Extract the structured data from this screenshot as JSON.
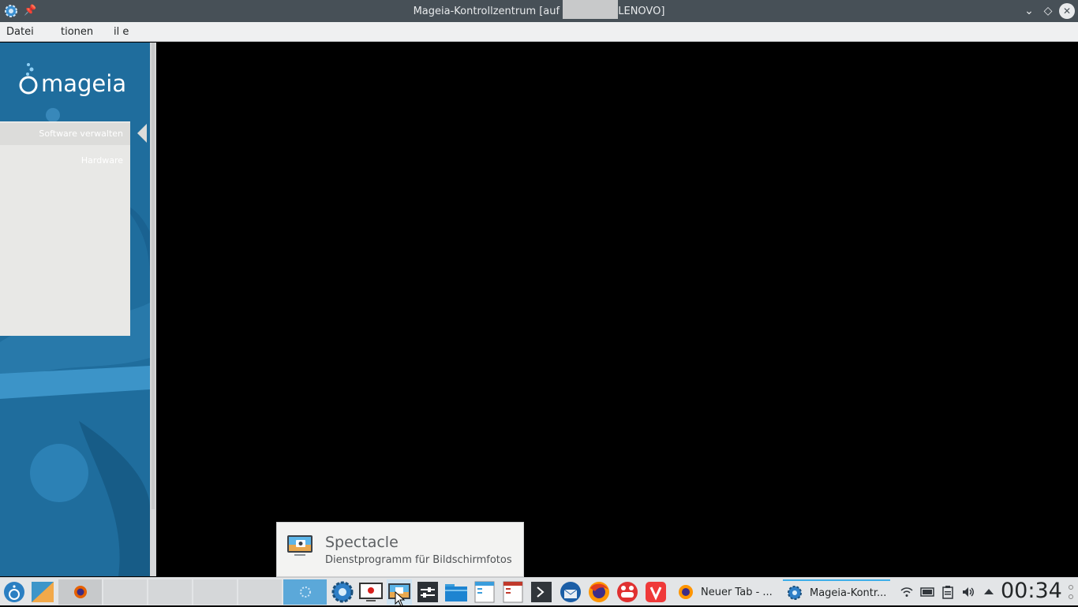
{
  "window": {
    "title_prefix": "Mageia-Kontrollzentrum [auf ",
    "title_suffix": "LENOVO]"
  },
  "menu": {
    "items": [
      "Datei",
      "tionen",
      "il e"
    ]
  },
  "sidebar": {
    "logo_text": "mageia",
    "categories": [
      {
        "label": "Software verwalten",
        "selected": true
      },
      {
        "label": "Hardware",
        "selected": false
      }
    ]
  },
  "tooltip": {
    "app_name": "Spectacle",
    "description": "Dienstprogramm für Bildschirmfotos"
  },
  "taskbar": {
    "tasks": [
      {
        "label": "Neuer Tab - ...",
        "icon": "firefox-icon"
      },
      {
        "label": "Mageia-Kontr...",
        "icon": "mageia-control-center-icon",
        "active": true
      }
    ],
    "clock": "00:34"
  },
  "colors": {
    "titlebar": "#475057",
    "sidebar_blue": "#1d6b9b",
    "accent": "#3daee9"
  }
}
